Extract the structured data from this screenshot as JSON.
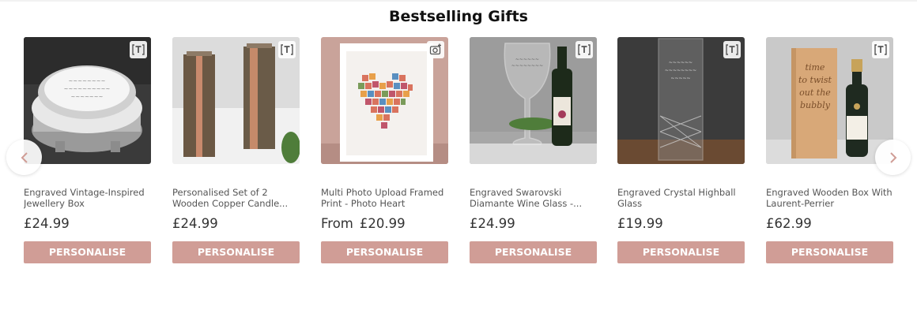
{
  "section": {
    "title": "Bestselling Gifts"
  },
  "carousel": {
    "prev_icon": "chevron-left-icon",
    "next_icon": "chevron-right-icon",
    "arrow_color": "#d09d96",
    "products": [
      {
        "name": "Engraved Vintage-Inspired Jewellery Box",
        "price_prefix": "",
        "price": "£24.99",
        "button": "PERSONALISE",
        "badge": "text-engraving-icon"
      },
      {
        "name": "Personalised Set of 2 Wooden Copper Candle...",
        "price_prefix": "",
        "price": "£24.99",
        "button": "PERSONALISE",
        "badge": "text-engraving-icon"
      },
      {
        "name": "Multi Photo Upload Framed Print - Photo Heart",
        "price_prefix": "From",
        "price": "£20.99",
        "button": "PERSONALISE",
        "badge": "photo-upload-icon"
      },
      {
        "name": "Engraved Swarovski Diamante Wine Glass -...",
        "price_prefix": "",
        "price": "£24.99",
        "button": "PERSONALISE",
        "badge": "text-engraving-icon"
      },
      {
        "name": "Engraved Crystal Highball Glass",
        "price_prefix": "",
        "price": "£19.99",
        "button": "PERSONALISE",
        "badge": "text-engraving-icon"
      },
      {
        "name": "Engraved Wooden Box With Laurent-Perrier Champagn...",
        "price_prefix": "",
        "price": "£62.99",
        "button": "PERSONALISE",
        "badge": "text-engraving-icon"
      }
    ]
  },
  "colors": {
    "button_bg": "#d09d96",
    "button_text": "#ffffff",
    "title": "#111111"
  }
}
